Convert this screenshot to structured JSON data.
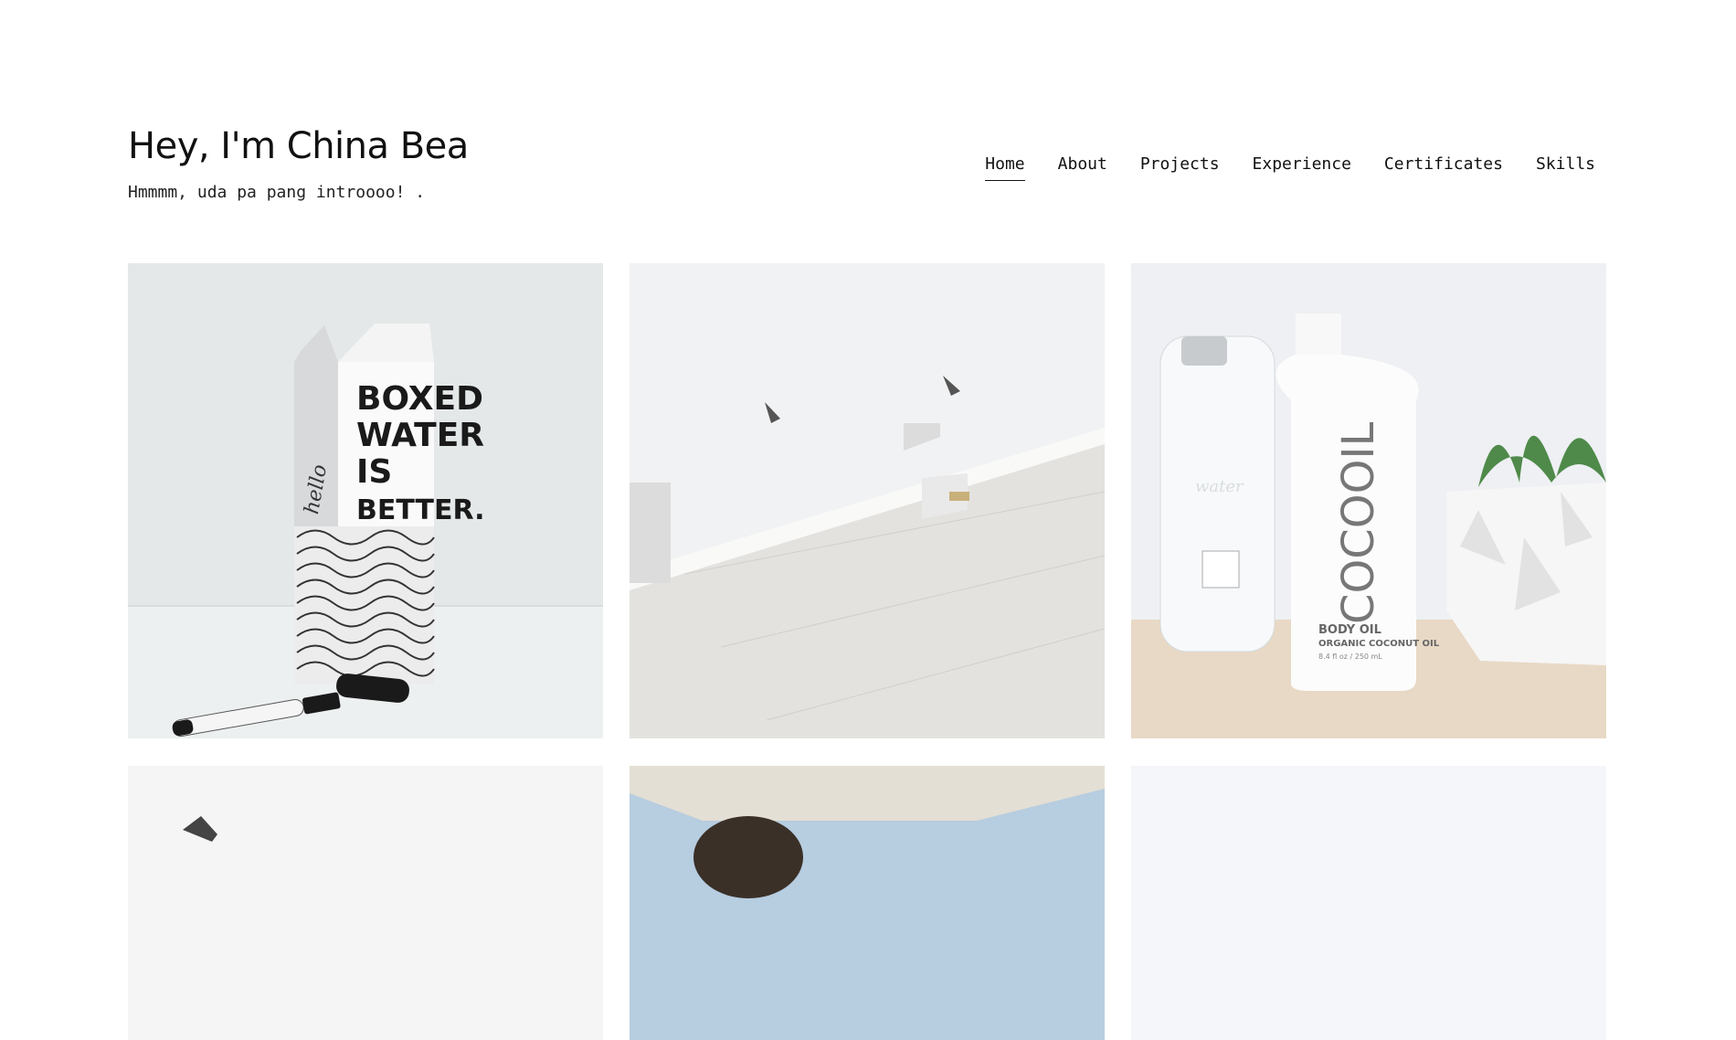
{
  "header": {
    "title": "Hey, I'm China Bea",
    "tagline": "Hmmmm, uda pa pang introooo! ."
  },
  "nav": {
    "items": [
      {
        "label": "Home",
        "active": true
      },
      {
        "label": "About",
        "active": false
      },
      {
        "label": "Projects",
        "active": false
      },
      {
        "label": "Experience",
        "active": false
      },
      {
        "label": "Certificates",
        "active": false
      },
      {
        "label": "Skills",
        "active": false
      }
    ]
  },
  "gallery": {
    "carton": {
      "lines": [
        "BOXED",
        "WATER",
        "IS",
        "BETTER."
      ],
      "script": "hello"
    },
    "bottle": {
      "brand": "COCOOIL",
      "line1": "BODY OIL",
      "line2": "ORGANIC COCONUT OIL",
      "line3": "8.4 fl oz / 250 mL",
      "glass_label": "water"
    }
  },
  "colors": {
    "text": "#111111",
    "background": "#ffffff"
  }
}
